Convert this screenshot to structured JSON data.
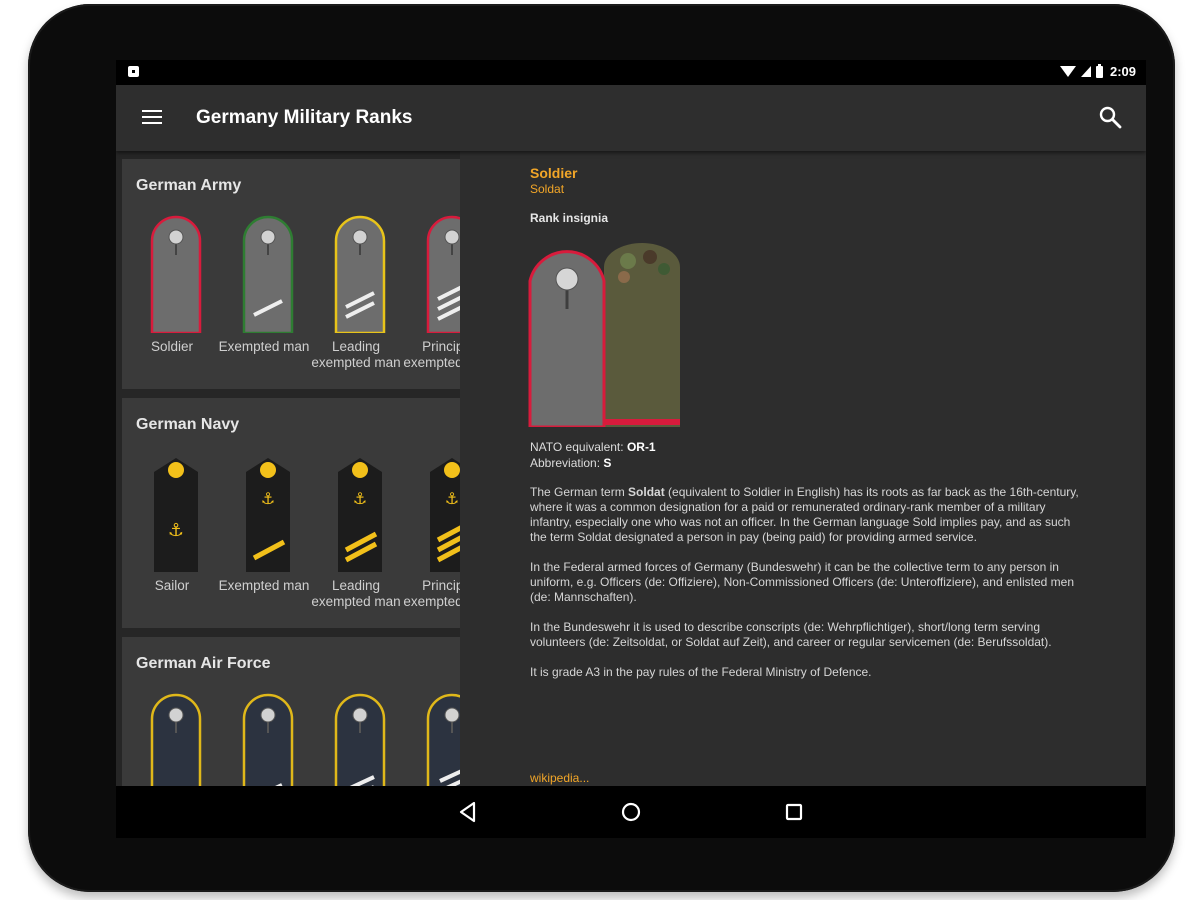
{
  "status_bar": {
    "time": "2:09",
    "icons": [
      "notification-icon",
      "wifi-icon",
      "signal-icon",
      "battery-icon"
    ]
  },
  "app_bar": {
    "title": "Germany Military Ranks",
    "menu_icon": "menu-icon",
    "search_icon": "search-icon"
  },
  "sections": [
    {
      "title": "German Army",
      "items": [
        {
          "label": "Soldier"
        },
        {
          "label": "Exempted man"
        },
        {
          "label": "Leading exempted man"
        },
        {
          "label": "Principal exempted man"
        }
      ]
    },
    {
      "title": "German Navy",
      "items": [
        {
          "label": "Sailor"
        },
        {
          "label": "Exempted man"
        },
        {
          "label": "Leading exempted man"
        },
        {
          "label": "Principal exempted man"
        }
      ]
    },
    {
      "title": "German Air Force",
      "items": [
        {
          "label": ""
        },
        {
          "label": ""
        },
        {
          "label": ""
        },
        {
          "label": ""
        }
      ]
    }
  ],
  "detail": {
    "title": "Soldier",
    "subtitle": "Soldat",
    "insignia_label": "Rank insignia",
    "nato_label": "NATO equivalent: ",
    "nato_value": "OR-1",
    "abbr_label": "Abbreviation: ",
    "abbr_value": "S",
    "p1_before": "The German term ",
    "p1_bold": "Soldat",
    "p1_after": " (equivalent to Soldier in English) has its roots as far back as the 16th-century, where it was a common designation for a paid or remunerated ordinary-rank member of a military infantry, especially one who was not an officer. In the German language Sold implies pay, and as such the term Soldat designated a person in pay (being paid) for providing armed service.",
    "p2": "In the Federal armed forces of Germany (Bundeswehr) it can be the collective term to any person in uniform, e.g. Officers (de: Offiziere), Non-Commissioned Officers (de: Unteroffiziere), and enlisted men (de: Mannschaften).",
    "p3": "In the Bundeswehr it is used to describe conscripts (de: Wehrpflichtiger), short/long term serving volunteers (de: Zeitsoldat, or Soldat auf Zeit), and career or regular servicemen (de: Berufssoldat).",
    "p4": "It is grade A3 in the pay rules of the Federal Ministry of Defence.",
    "link": "wikipedia..."
  },
  "nav_bar": {
    "icons": [
      "back-icon",
      "home-icon",
      "recents-icon"
    ]
  },
  "colors": {
    "accent": "#f2a628",
    "army_soldier_border": "#d81b3c",
    "army_exempted_border": "#2e7d32",
    "army_leading_border": "#e8c41a",
    "navy_board": "#1c1c1c",
    "navy_gold": "#f2c01a",
    "airforce_board": "#2c3340",
    "airforce_border": "#e0b81a"
  }
}
